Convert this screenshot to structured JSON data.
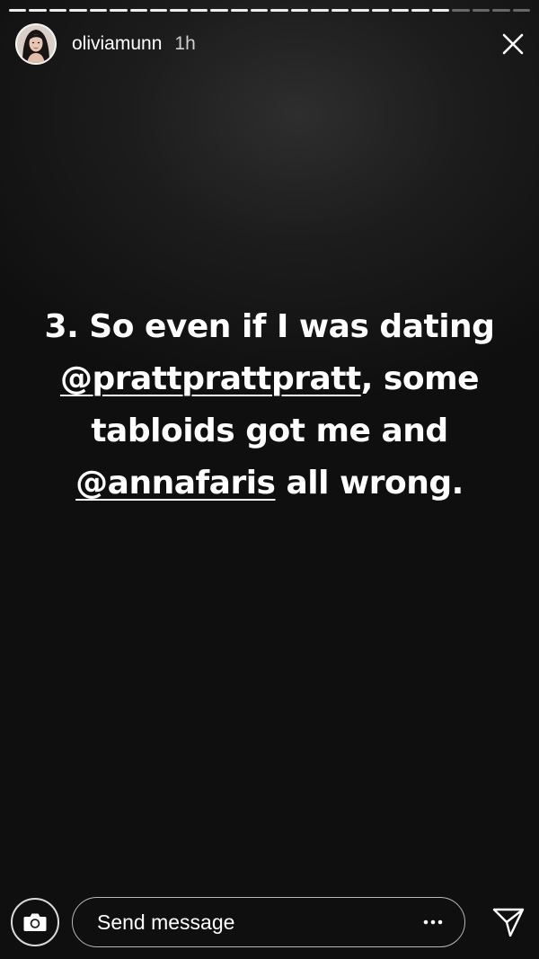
{
  "story": {
    "progress": {
      "total_segments": 26,
      "seen_segments": 22
    }
  },
  "header": {
    "username": "oliviamunn",
    "timestamp": "1h",
    "avatar_icon": "profile-photo",
    "close_icon": "close-icon"
  },
  "caption": {
    "lines": [
      [
        {
          "text": "3. So even if I was dating",
          "mention": false
        }
      ],
      [
        {
          "text": "@prattprattpratt",
          "mention": true
        },
        {
          "text": ", some",
          "mention": false
        }
      ],
      [
        {
          "text": "tabloids got me and",
          "mention": false
        }
      ],
      [
        {
          "text": "@annafaris",
          "mention": true
        },
        {
          "text": " all wrong.",
          "mention": false
        }
      ]
    ]
  },
  "footer": {
    "camera_icon": "camera-icon",
    "message_placeholder": "Send message",
    "more_icon": "ellipsis-icon",
    "send_icon": "paper-plane-icon"
  },
  "colors": {
    "background_dark": "#0f0f0f",
    "background_light": "#2e2e2e",
    "text": "#ffffff"
  }
}
